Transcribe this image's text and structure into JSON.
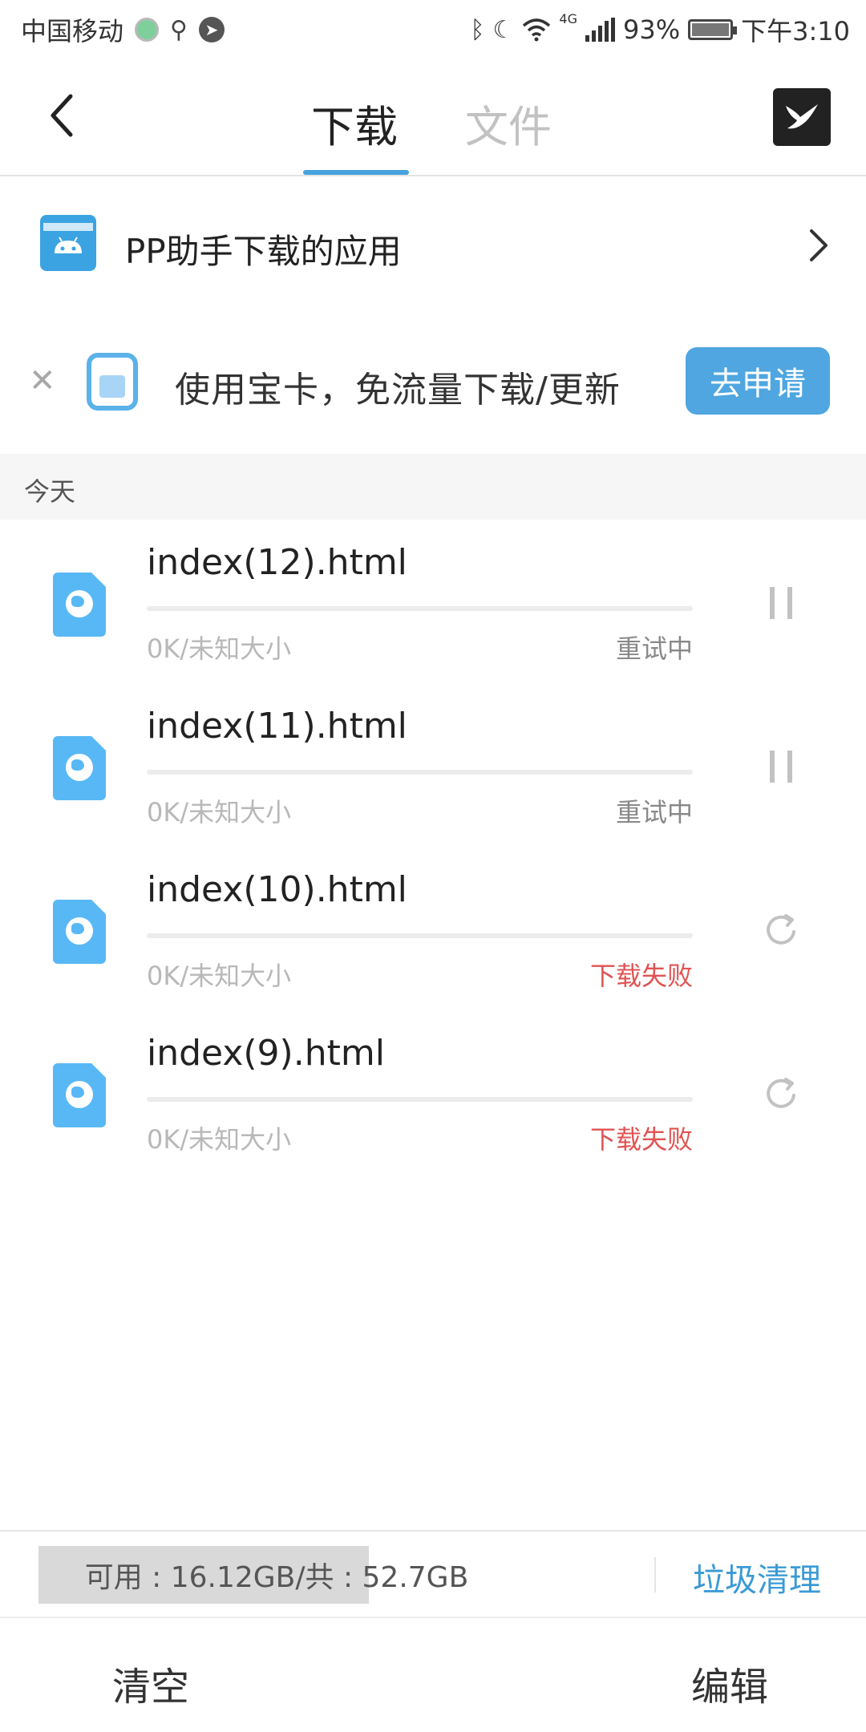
{
  "status_bar": {
    "carrier": "中国移动",
    "network": "4G",
    "battery": "93%",
    "time": "下午3:10"
  },
  "header": {
    "tabs": [
      {
        "label": "下载",
        "active": true
      },
      {
        "label": "文件",
        "active": false
      }
    ]
  },
  "pp_row": {
    "label": "PP助手下载的应用"
  },
  "banner": {
    "text": "使用宝卡，免流量下载/更新",
    "button": "去申请"
  },
  "section": {
    "label": "今天"
  },
  "downloads": [
    {
      "name": "index(12).html",
      "size": "0K/未知大小",
      "status": "重试中",
      "status_type": "retry",
      "action": "pause",
      "progress": 0
    },
    {
      "name": "index(11).html",
      "size": "0K/未知大小",
      "status": "重试中",
      "status_type": "retry",
      "action": "pause",
      "progress": 0
    },
    {
      "name": "index(10).html",
      "size": "0K/未知大小",
      "status": "下载失败",
      "status_type": "fail",
      "action": "retry",
      "progress": 0
    },
    {
      "name": "index(9).html",
      "size": "0K/未知大小",
      "status": "下载失败",
      "status_type": "fail",
      "action": "retry",
      "progress": 0
    }
  ],
  "storage": {
    "text": "可用 : 16.12GB/共 : 52.7GB",
    "used_fraction": 0.694,
    "clean_label": "垃圾清理"
  },
  "bottom_bar": {
    "clear_label": "清空",
    "edit_label": "编辑"
  },
  "colors": {
    "accent": "#46a3dd",
    "fail": "#e05353",
    "file_icon": "#58b8f5"
  }
}
